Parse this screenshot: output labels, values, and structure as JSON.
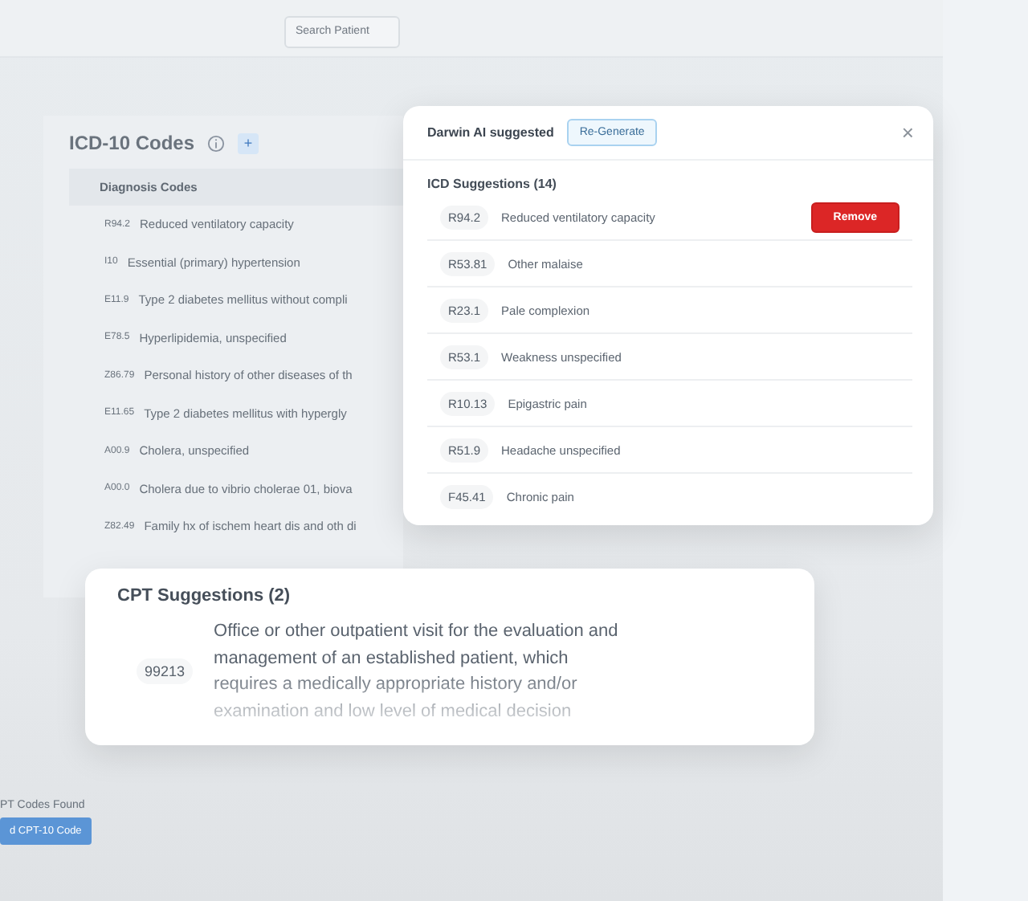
{
  "background": {
    "search": {
      "placeholder": "Search Patient"
    },
    "icd_panel": {
      "title": "ICD-10 Codes",
      "badge": "+",
      "column": "Diagnosis Codes",
      "rows": [
        {
          "code": "R94.2",
          "description": "Reduced ventilatory capacity"
        },
        {
          "code": "I10",
          "description": "Essential (primary) hypertension"
        },
        {
          "code": "E11.9",
          "description": "Type 2 diabetes mellitus without compli"
        },
        {
          "code": "E78.5",
          "description": "Hyperlipidemia, unspecified"
        },
        {
          "code": "Z86.79",
          "description": "Personal history of other diseases of th"
        },
        {
          "code": "E11.65",
          "description": "Type 2 diabetes mellitus with hypergly"
        },
        {
          "code": "A00.9",
          "description": "Cholera, unspecified"
        },
        {
          "code": "A00.0",
          "description": "Cholera due to vibrio cholerae 01, biova"
        },
        {
          "code": "Z82.49",
          "description": "Family hx of ischem heart dis and oth di"
        }
      ]
    },
    "cpt_found": "PT Codes Found",
    "add_button": "d CPT-10 Code"
  },
  "popup": {
    "title": "Darwin AI suggested",
    "regenerate": "Re-Generate",
    "close": "×",
    "section": "ICD Suggestions (14)",
    "rows": [
      {
        "code": "R94.2",
        "description": "Reduced ventilatory capacity",
        "action": "Remove"
      },
      {
        "code": "R53.81",
        "description": "Other malaise"
      },
      {
        "code": "R23.1",
        "description": "Pale complexion"
      },
      {
        "code": "R53.1",
        "description": "Weakness unspecified"
      },
      {
        "code": "R10.13",
        "description": "Epigastric pain"
      },
      {
        "code": "R51.9",
        "description": "Headache unspecified"
      },
      {
        "code": "F45.41",
        "description": "Chronic pain"
      }
    ]
  },
  "cpt_card": {
    "title": "CPT Suggestions (2)",
    "code": "99213",
    "description": "Office or other outpatient visit for the evaluation and management of an established patient, which requires a medically appropriate history and/or examination and low level of medical decision"
  }
}
